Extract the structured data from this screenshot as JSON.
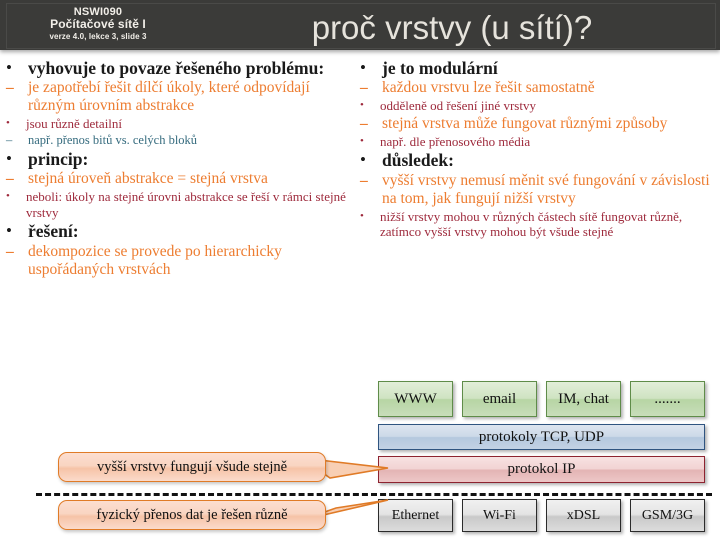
{
  "header": {
    "course_code": "NSWI090",
    "course_name": "Počítačové sítě I",
    "version_line": "verze 4.0, lekce 3, slide 3",
    "title": "proč vrstvy (u sítí)?",
    "bg_color": "#3b3b39",
    "title_color": "#e6e3dc"
  },
  "colors": {
    "level1": "#1a1a1a",
    "level2": "#ED7D31",
    "level3": "#9E2A3C",
    "level4": "#356B7E",
    "callout_border": "#E07B27"
  },
  "bullets": {
    "dot": "•",
    "dash": "–",
    "small_dot": "•"
  },
  "left_column": [
    {
      "level": 1,
      "text": "vyhovuje to povaze řešeného problému:"
    },
    {
      "level": 2,
      "text": "je zapotřebí řešit dílčí úkoly, které odpovídají různým úrovním abstrakce"
    },
    {
      "level": 3,
      "text": "jsou různě detailní"
    },
    {
      "level": 4,
      "text": "např. přenos bitů vs. celých bloků"
    },
    {
      "level": 1,
      "text": "princip:"
    },
    {
      "level": 2,
      "text": "stejná úroveň abstrakce = stejná vrstva"
    },
    {
      "level": 3,
      "text": "neboli: úkoly na stejné úrovni abstrakce se řeší v rámci stejné vrstvy"
    },
    {
      "level": 1,
      "text": "řešení:"
    },
    {
      "level": 2,
      "text": "dekompozice se provede po hierarchicky uspořádaných vrstvách"
    }
  ],
  "right_column": [
    {
      "level": 1,
      "text": "je to modulární"
    },
    {
      "level": 2,
      "text": "každou vrstvu lze řešit samostatně"
    },
    {
      "level": 3,
      "text": "odděleně od řešení jiné vrstvy"
    },
    {
      "level": 2,
      "text": "stejná vrstva může fungovat různými způsoby"
    },
    {
      "level": 3,
      "text": "např. dle přenosového média"
    },
    {
      "level": 1,
      "text": "důsledek:"
    },
    {
      "level": 2,
      "text": "vyšší vrstvy nemusí měnit své fungování v závislosti na tom, jak fungují nižší vrstvy"
    },
    {
      "level": 3,
      "text": "nižší vrstvy mohou v různých částech sítě fungovat různě, zatímco vyšší vrstvy mohou být všude stejné"
    }
  ],
  "diagram": {
    "application_layer": [
      "WWW",
      "email",
      "IM, chat",
      "......."
    ],
    "transport_layer": "protokoly TCP, UDP",
    "network_layer": "protokol IP",
    "link_layer": [
      "Ethernet",
      "Wi-Fi",
      "xDSL",
      "GSM/3G"
    ]
  },
  "callouts": [
    {
      "text": "vyšší vrstvy fungují všude stejně"
    },
    {
      "text": "fyzický přenos dat je řešen různě"
    }
  ]
}
